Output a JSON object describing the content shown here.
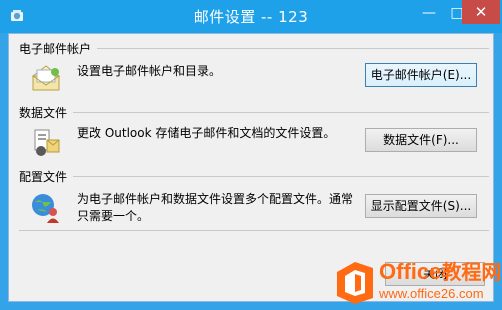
{
  "window": {
    "title": "邮件设置 -- 123"
  },
  "titlebar": {
    "minimize": "—",
    "maximize": "□",
    "close": "✕"
  },
  "sections": [
    {
      "title": "电子邮件帐户",
      "description": "设置电子邮件帐户和目录。",
      "button": "电子邮件帐户(E)...",
      "icon": "email-accounts-icon"
    },
    {
      "title": "数据文件",
      "description": "更改 Outlook 存储电子邮件和文档的文件设置。",
      "button": "数据文件(F)...",
      "icon": "data-files-icon"
    },
    {
      "title": "配置文件",
      "description_line1": "为电子邮件帐户和数据文件设置多个配置文件。通常",
      "description_line2": "只需要一个。",
      "button": "显示配置文件(S)...",
      "icon": "profiles-icon"
    }
  ],
  "footer": {
    "close_label": "关闭"
  },
  "watermark": {
    "brand": "Office",
    "brand_suffix": "教程网",
    "url": "www.office26.com"
  },
  "colors": {
    "titlebar": "#1ea1e8",
    "close_button": "#c74b46",
    "watermark": "#ff6a13"
  }
}
